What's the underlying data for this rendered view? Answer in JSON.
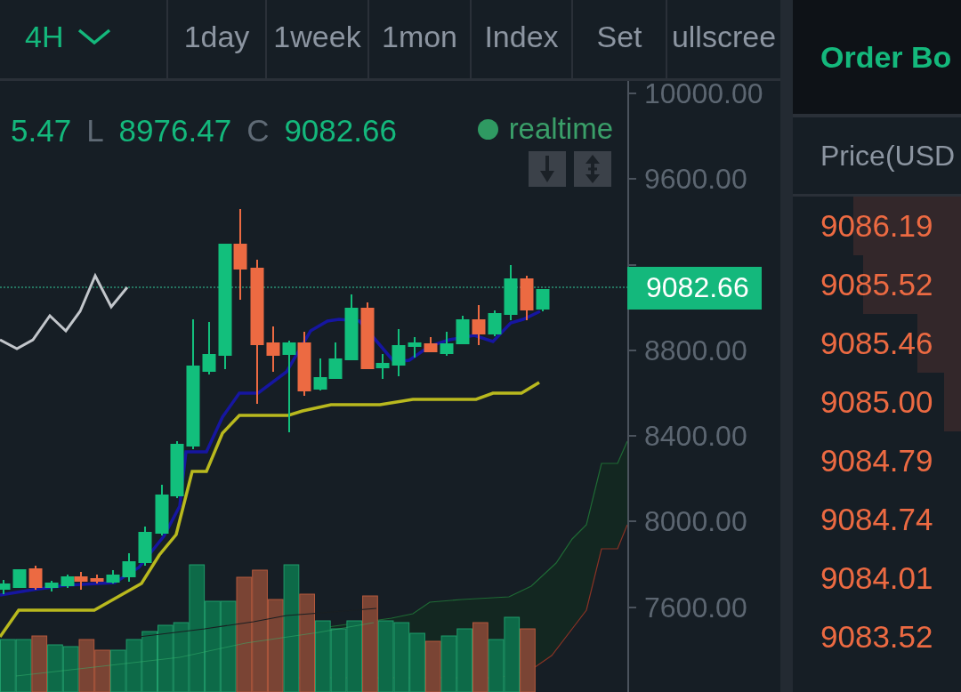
{
  "toolbar": {
    "items": [
      {
        "label": "4H",
        "kind": "dropdown",
        "selected": true
      },
      {
        "label": "1day",
        "kind": "interval",
        "selected": false
      },
      {
        "label": "1week",
        "kind": "interval",
        "selected": false
      },
      {
        "label": "1mon",
        "kind": "interval",
        "selected": false
      },
      {
        "label": "Index",
        "kind": "button",
        "selected": false
      },
      {
        "label": "Set",
        "kind": "button",
        "selected": false
      },
      {
        "label": "ullscree",
        "kind": "button",
        "selected": false
      }
    ]
  },
  "chart": {
    "readings": [
      {
        "value": "5.47"
      },
      {
        "label": "L",
        "value": "8976.47"
      },
      {
        "label": "C",
        "value": "9082.66"
      }
    ],
    "status": {
      "label": "realtime"
    },
    "buttons": [
      {
        "kind": "down_arrow"
      },
      {
        "kind": "up_down_arrow"
      }
    ]
  },
  "price_axis": {
    "labels_above": [
      "10000.00",
      "9600.00"
    ],
    "current_price": "9082.66",
    "labels_below": [
      "8800.00",
      "8400.00",
      "8000.00",
      "7600.00"
    ]
  },
  "order_book": {
    "title": "Order Bo",
    "column_header": "Price(USD",
    "asks": [
      {
        "price": "9086.19",
        "level": 0.64
      },
      {
        "price": "9085.52",
        "level": 0.58
      },
      {
        "price": "9085.46",
        "level": 0.26
      },
      {
        "price": "9085.00",
        "level": 0.1
      },
      {
        "price": "9084.79"
      },
      {
        "price": "9084.74"
      },
      {
        "price": "9084.01"
      },
      {
        "price": "9083.52"
      }
    ]
  }
}
